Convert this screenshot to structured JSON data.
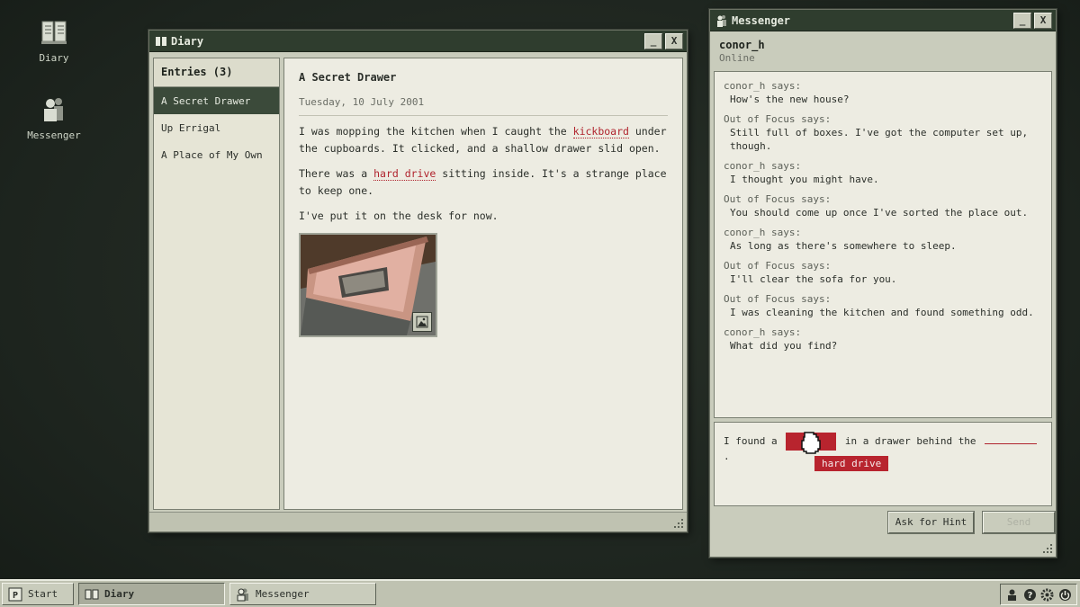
{
  "desktop": {
    "icons": [
      {
        "label": "Diary",
        "icon": "diary-icon"
      },
      {
        "label": "Messenger",
        "icon": "messenger-icon"
      }
    ]
  },
  "diary": {
    "title": "Diary",
    "sidebar_header": "Entries (3)",
    "entries": [
      "A Secret Drawer",
      "Up Errigal",
      "A Place of My Own"
    ],
    "active_entry": "A Secret Drawer",
    "entry": {
      "title": "A Secret Drawer",
      "date": "Tuesday, 10 July 2001",
      "p1_before": "I was mopping the kitchen when I caught the ",
      "p1_keyword": "kickboard",
      "p1_after": " under the cupboards. It clicked, and a shallow drawer slid open.",
      "p2_before": "There was a ",
      "p2_keyword": "hard drive",
      "p2_after": " sitting inside. It's a strange place to keep one.",
      "p3": "I've put it on the desk for now."
    },
    "photo_icon": "image-icon",
    "buttons": {
      "minimize": "_",
      "close": "X"
    }
  },
  "messenger": {
    "title": "Messenger",
    "contact_name": "conor_h",
    "contact_status": "Online",
    "messages": [
      {
        "who": "conor_h says:",
        "text": "How's the new house?"
      },
      {
        "who": "Out of Focus says:",
        "text": "Still full of boxes. I've got the computer set up, though."
      },
      {
        "who": "conor_h says:",
        "text": "I thought you might have."
      },
      {
        "who": "Out of Focus says:",
        "text": "You should come up once I've sorted the place out."
      },
      {
        "who": "conor_h says:",
        "text": "As long as there's somewhere to sleep."
      },
      {
        "who": "Out of Focus says:",
        "text": "I'll clear the sofa for you."
      },
      {
        "who": "Out of Focus says:",
        "text": "I was cleaning the kitchen and found something odd."
      },
      {
        "who": "conor_h says:",
        "text": "What did you find?"
      }
    ],
    "compose": {
      "part1": "I found a",
      "part2": "in a drawer behind the",
      "part3": ".",
      "chip": "hard drive"
    },
    "hint_button": "Ask for Hint",
    "send_button": "Send",
    "buttons": {
      "minimize": "_",
      "close": "X"
    }
  },
  "taskbar": {
    "start_label": "Start",
    "start_glyph": "P",
    "tasks": [
      {
        "label": "Diary",
        "active": true
      },
      {
        "label": "Messenger",
        "active": false
      }
    ],
    "tray_icons": [
      "user-icon",
      "help-icon",
      "settings-icon",
      "power-icon"
    ]
  },
  "colors": {
    "titlebar": "#2f3d2e",
    "accent_red": "#b8242e",
    "window_bg": "#c9ccbc",
    "paper": "#edece2"
  }
}
